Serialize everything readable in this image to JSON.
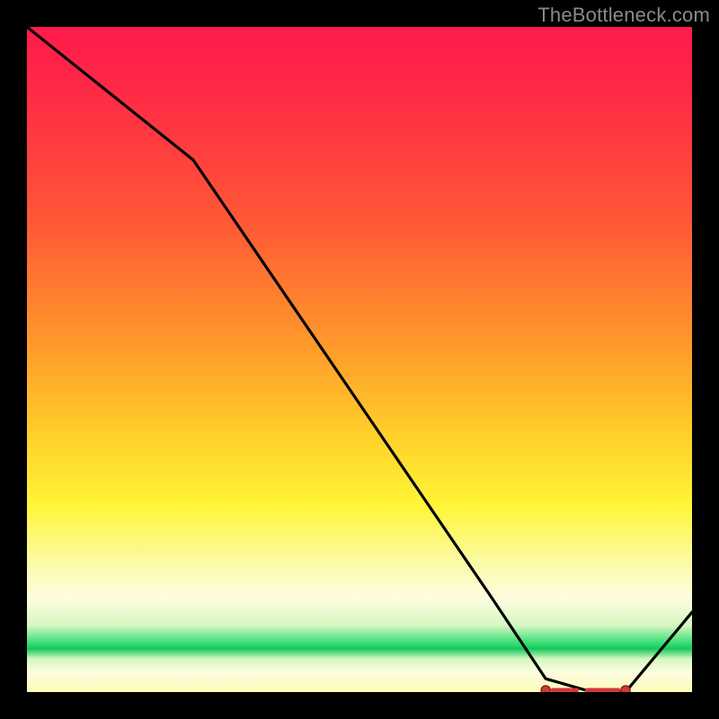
{
  "attribution": "TheBottleneck.com",
  "colors": {
    "frame": "#000000",
    "curve": "#000000",
    "marker_fill": "#d23a3a",
    "marker_stroke": "#8a1e1e",
    "gradient_top": "#ff1a4b",
    "gradient_mid": "#ffd22a",
    "gradient_low": "#fbfbb8",
    "gradient_green": "#17c85d"
  },
  "chart_data": {
    "type": "line",
    "title": "",
    "xlabel": "",
    "ylabel": "",
    "xlim": [
      0,
      100
    ],
    "ylim": [
      0,
      100
    ],
    "x": [
      0,
      25,
      40,
      55,
      70,
      78,
      85,
      90,
      100
    ],
    "values": [
      100,
      80,
      58,
      36,
      14,
      2,
      0,
      0,
      12
    ],
    "optimal_region_x": [
      78,
      90
    ],
    "description": "Single black curve over a vertical red-to-green heat gradient. Curve descends from top-left, reaches the green minimum band around x≈78–90, then rises slightly toward the right edge. A short horizontal red dotted/dashed marker sits on the curve's minimum inside the green band."
  }
}
